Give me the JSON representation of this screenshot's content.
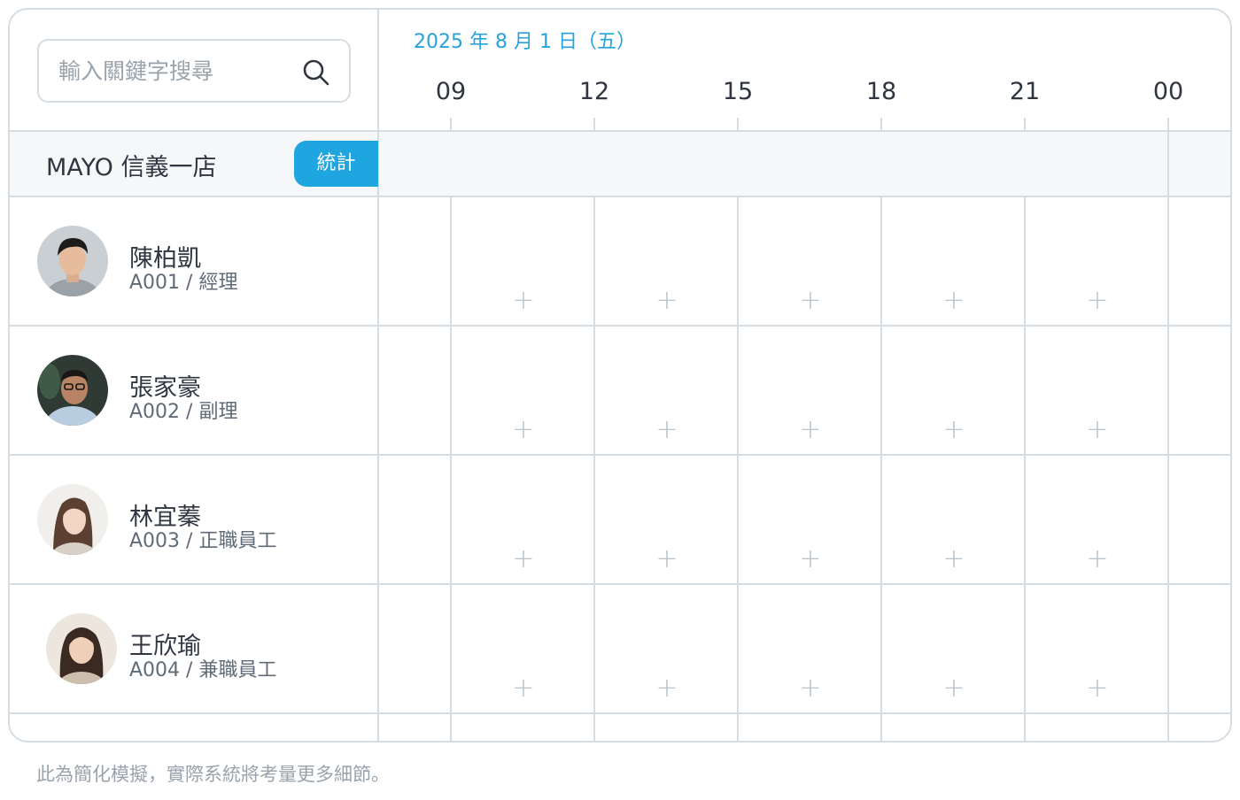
{
  "search": {
    "placeholder": "輸入關鍵字搜尋",
    "icon": "search-icon"
  },
  "schedule": {
    "date_label": "2025 年 8 月 1 日（五）",
    "hours": [
      "09",
      "12",
      "15",
      "18",
      "21",
      "00"
    ]
  },
  "store": {
    "name": "MAYO 信義一店",
    "stats_label": "統計",
    "accent_color": "#1fa5e0"
  },
  "employees": [
    {
      "name": "陳柏凱",
      "meta": "A001 / 經理"
    },
    {
      "name": "張家豪",
      "meta": "A002 / 副理"
    },
    {
      "name": "林宜蓁",
      "meta": "A003 / 正職員工"
    },
    {
      "name": "王欣瑜",
      "meta": "A004 / 兼職員工"
    }
  ],
  "add_shift_symbol": "+",
  "footer_note": "此為簡化模擬，實際系統將考量更多細節。"
}
